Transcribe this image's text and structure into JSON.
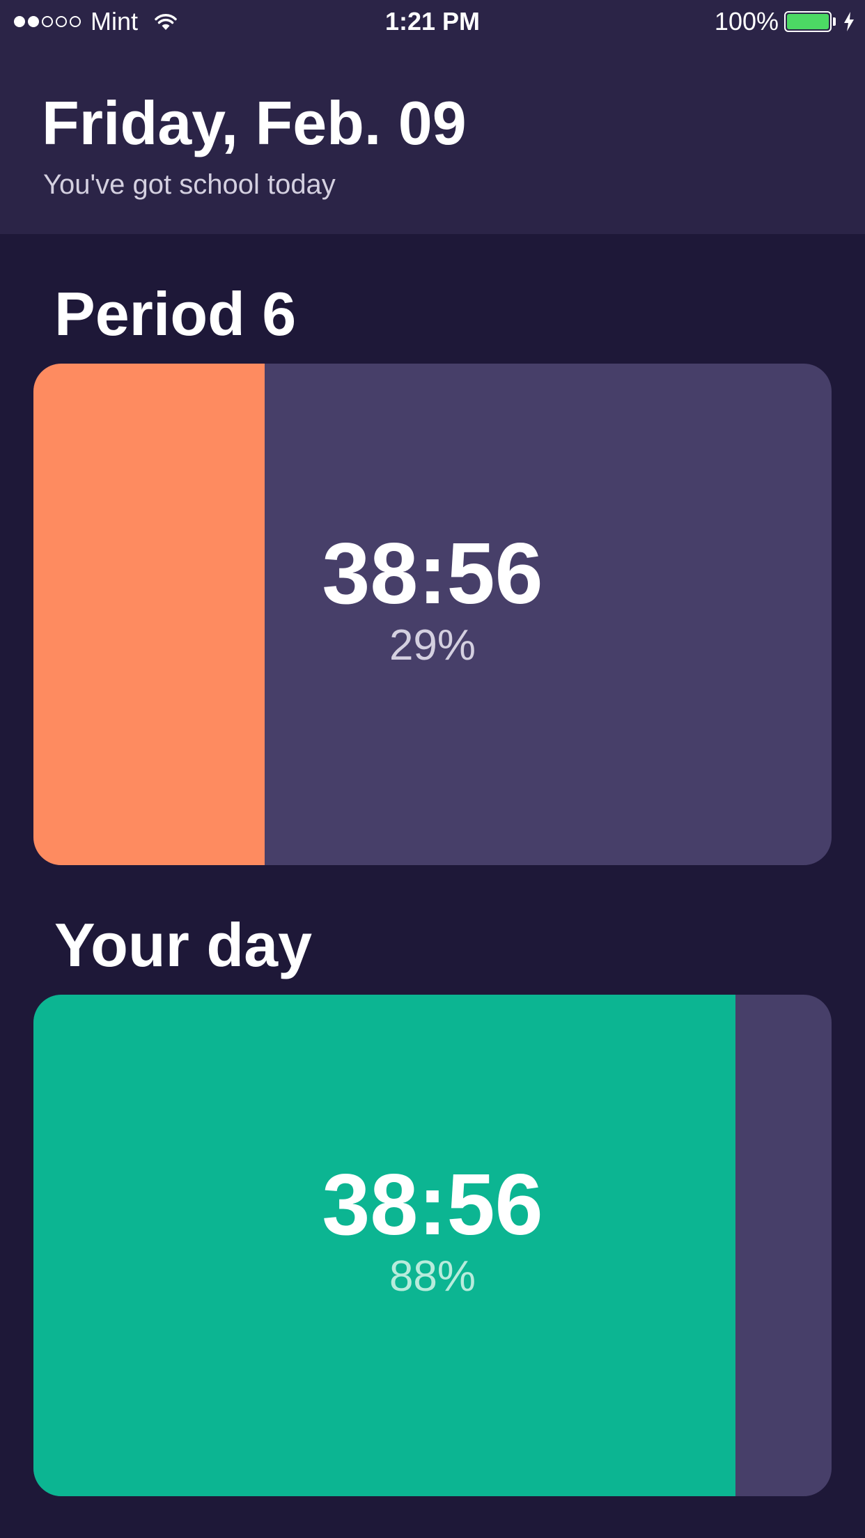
{
  "status_bar": {
    "signal_filled": 2,
    "signal_total": 5,
    "carrier": "Mint",
    "time": "1:21 PM",
    "battery_percent": "100%",
    "battery_level": 1.0,
    "battery_color": "#4cd964",
    "icons": [
      "signal-dots",
      "wifi-icon",
      "battery-icon",
      "charging-bolt-icon"
    ]
  },
  "header": {
    "date": "Friday, Feb. 09",
    "subtitle": "You've got school today",
    "background": "#2b2447"
  },
  "period": {
    "title": "Period 6",
    "timer": "38:56",
    "percent": "29%",
    "progress": 0.29,
    "fill_color": "#fe8b60",
    "track_color": "#473f69"
  },
  "day": {
    "title": "Your day",
    "timer": "38:56",
    "percent": "88%",
    "progress": 0.88,
    "fill_color": "#0cb592",
    "track_color": "#473f69"
  },
  "colors": {
    "background": "#1e1838"
  }
}
